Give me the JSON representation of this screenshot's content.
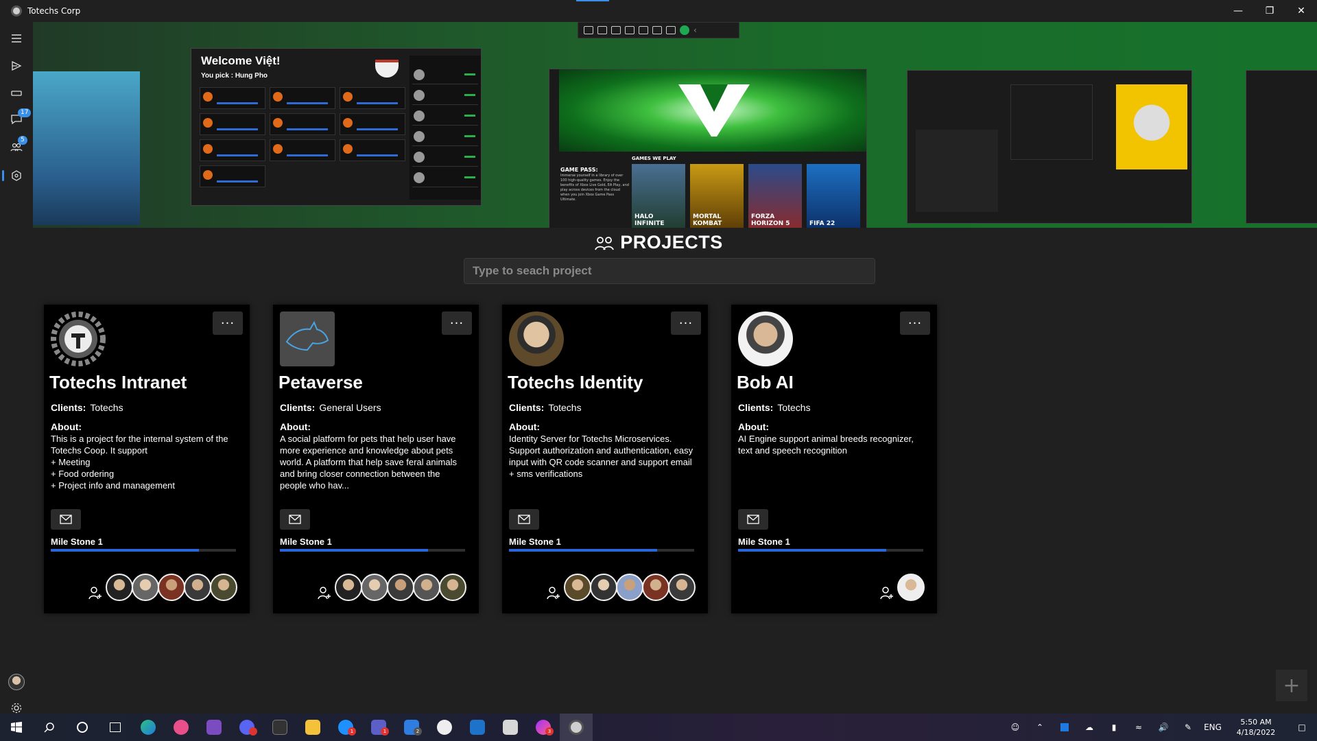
{
  "window": {
    "title": "Totechs Corp",
    "controls": {
      "minimize": "—",
      "maximize": "❐",
      "close": "✕"
    }
  },
  "nav": {
    "badges": {
      "messages": "17",
      "team": "5"
    },
    "icons": [
      "menu-icon",
      "send-icon",
      "ticket-icon",
      "chat-icon",
      "team-icon",
      "projects-icon",
      "avatar",
      "gear-icon"
    ]
  },
  "banner": {
    "slide_welcome": {
      "title": "Welcome Việt!",
      "subtitle": "You pick : Hung Pho"
    },
    "slide_games": {
      "game_pass_title": "GAME PASS:",
      "game_pass_text": "Immerse yourself in a library of over 100 high-quality games. Enjoy the benefits of Xbox Live Gold, EA Play, and play across devices from the cloud when you join Xbox Game Pass Ultimate.",
      "games_title": "GAMES WE PLAY",
      "games": [
        "HALO INFINITE",
        "MORTAL KOMBAT",
        "FORZA HORIZON 5",
        "FIFA 22"
      ]
    }
  },
  "projects": {
    "title": "PROJECTS",
    "search_placeholder": "Type to seach project",
    "clients_label": "Clients:",
    "about_label": "About:",
    "cards": [
      {
        "name": "Totechs Intranet",
        "clients": "Totechs",
        "about": "This is a project for the internal system of the Totechs Coop. It support\n+ Meeting\n+ Food ordering\n+ Project info and management",
        "milestone": "Mile Stone 1",
        "progress": 0.8,
        "members": 5
      },
      {
        "name": "Petaverse",
        "clients": "General Users",
        "about": "A social platform for pets that help user have more experience and knowledge about pets world. A platform that help save feral animals and bring closer connection between the people who hav...",
        "milestone": "Mile Stone 1",
        "progress": 0.8,
        "members": 5
      },
      {
        "name": "Totechs Identity",
        "clients": "Totechs",
        "about": "Identity Server for Totechs Microservices. Support authorization and authentication, easy input with QR code scanner and support email + sms verifications",
        "milestone": "Mile Stone 1",
        "progress": 0.8,
        "members": 5
      },
      {
        "name": "Bob AI",
        "clients": "Totechs",
        "about": "AI Engine support animal breeds recognizer, text and speech recognition",
        "milestone": "Mile Stone 1",
        "progress": 0.8,
        "members": 1
      }
    ]
  },
  "add_button": "+",
  "taskbar": {
    "apps": [
      "windows-start",
      "search",
      "cortana",
      "task-view",
      "edge",
      "dribbble",
      "visual-studio",
      "discord",
      "terminal",
      "file-explorer",
      "skype",
      "teams",
      "vs-code-insiders",
      "github",
      "azure-data-studio",
      "briefcase",
      "messenger",
      "totechs-corp"
    ],
    "badges": {
      "skype": "1",
      "teams": "1",
      "todo": "2",
      "messenger": "3"
    },
    "tray": {
      "language": "ENG",
      "time": "5:50 AM",
      "date": "4/18/2022"
    }
  },
  "colors": {
    "accent": "#2a66d9",
    "card_bg": "#000000",
    "page_bg": "#202020"
  }
}
